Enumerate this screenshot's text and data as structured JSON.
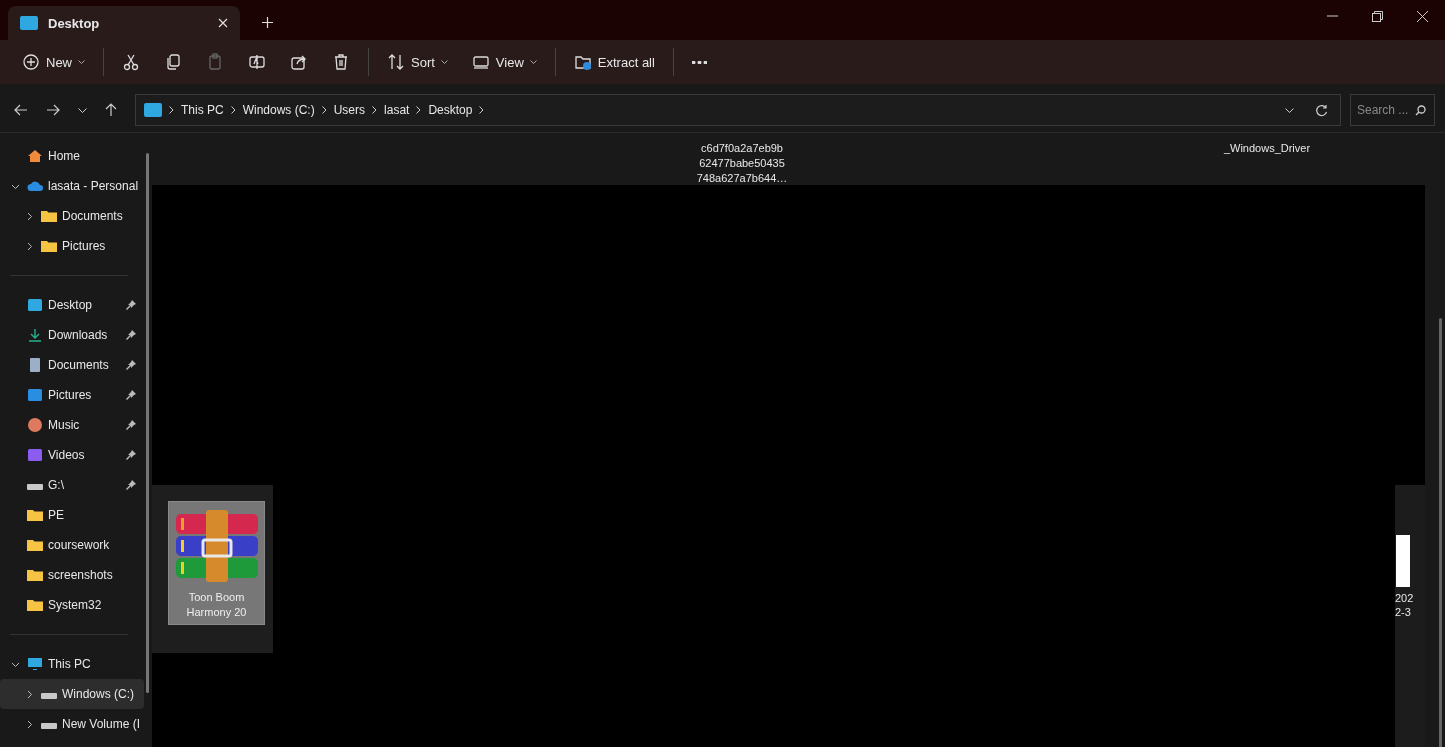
{
  "window": {
    "tab_title": "Desktop"
  },
  "toolbar": [
    {
      "kind": "menu",
      "label": "New",
      "disabled": false
    },
    {
      "kind": "icon",
      "disabled": false
    },
    {
      "kind": "icon",
      "disabled": false
    },
    {
      "kind": "icon",
      "disabled": true
    },
    {
      "kind": "icon",
      "disabled": false
    },
    {
      "kind": "icon",
      "disabled": false
    },
    {
      "kind": "icon",
      "disabled": false
    },
    {
      "kind": "menu",
      "label": "Sort",
      "disabled": false
    },
    {
      "kind": "menu",
      "label": "View",
      "disabled": false
    },
    {
      "kind": "button",
      "label": "Extract all",
      "disabled": false
    },
    {
      "kind": "icon",
      "disabled": false
    }
  ],
  "address": {
    "crumbs": [
      "This PC",
      "Windows (C:)",
      "Users",
      "lasat",
      "Desktop"
    ]
  },
  "search": {
    "placeholder": "Search ..."
  },
  "sidebar": {
    "groups": [
      [
        {
          "label": "Home",
          "kind": "home",
          "selected": false
        },
        {
          "label": "lasata - Personal",
          "kind": "cloud",
          "expanded": true,
          "selected": false,
          "children": [
            {
              "label": "Documents",
              "kind": "folder",
              "expanded": false,
              "selected": false
            },
            {
              "label": "Pictures",
              "kind": "folder",
              "expanded": false,
              "selected": false
            }
          ]
        }
      ],
      [
        {
          "label": "Desktop",
          "kind": "desktop",
          "pinned": true,
          "selected": false
        },
        {
          "label": "Downloads",
          "kind": "download",
          "pinned": true,
          "selected": false
        },
        {
          "label": "Documents",
          "kind": "document",
          "pinned": true,
          "selected": false
        },
        {
          "label": "Pictures",
          "kind": "picture",
          "pinned": true,
          "selected": false
        },
        {
          "label": "Music",
          "kind": "music",
          "pinned": true,
          "selected": false
        },
        {
          "label": "Videos",
          "kind": "video",
          "pinned": true,
          "selected": false
        },
        {
          "label": "G:\\",
          "kind": "drive",
          "pinned": true,
          "selected": false
        },
        {
          "label": "PE",
          "kind": "folder",
          "pinned": false,
          "selected": false
        },
        {
          "label": "coursework",
          "kind": "folder",
          "pinned": false,
          "selected": false
        },
        {
          "label": "screenshots",
          "kind": "folder",
          "pinned": false,
          "selected": false
        },
        {
          "label": "System32",
          "kind": "folder",
          "pinned": false,
          "selected": false
        }
      ],
      [
        {
          "label": "This PC",
          "kind": "pc",
          "expanded": true,
          "selected": false,
          "children": [
            {
              "label": "Windows (C:)",
              "kind": "drive",
              "expanded": false,
              "selected": true
            },
            {
              "label": "New Volume (I",
              "kind": "drive",
              "expanded": false,
              "selected": false
            }
          ]
        }
      ]
    ]
  },
  "files": {
    "top_row": [
      {
        "name_lines": [
          "c6d7f0a2a7eb9b",
          "62477babe50435",
          "748a627a7b644…"
        ]
      },
      {
        "name_lines": [
          "_Windows_Driver"
        ]
      }
    ],
    "tile": {
      "name": "Toon Boom Harmony 20",
      "selected": true
    },
    "partial": {
      "name_lines": [
        "202",
        "2-3"
      ]
    }
  }
}
